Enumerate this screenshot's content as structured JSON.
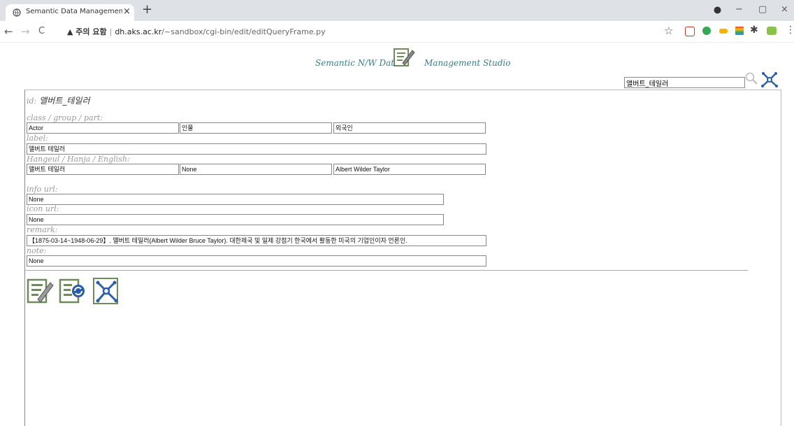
{
  "browser": {
    "tab_title": "Semantic Data Management St",
    "tab_close": "×",
    "new_tab": "+",
    "address": {
      "warning": "▲ 주의 요함",
      "separator": "|",
      "host": "dh.aks.ac.kr",
      "path": "/~sandbox/cgi-bin/edit/editQueryFrame.py"
    },
    "nav": {
      "back": "←",
      "forward": "→",
      "reload": "C"
    },
    "window": {
      "minimize": "−",
      "maximize": "▢",
      "close": "×"
    },
    "toolbar_icons": {
      "star": "☆",
      "puzzle": "✱",
      "menu": "⋮"
    }
  },
  "header": {
    "title_left": "Semantic N/W Data",
    "title_right": "Management Studio",
    "icon": "edit-document-icon"
  },
  "search": {
    "value": "앨버트_테일러"
  },
  "form": {
    "id_label": "id:",
    "id_value": "앨버트_테일러",
    "class_label": "class / group / part:",
    "class": "Actor",
    "group": "인물",
    "part": "외국인",
    "label_label": "label:",
    "label": "앨버트 테일러",
    "names_label": "Hangeul / Hanja / English:",
    "hangeul": "앨버트 테일러",
    "hanja": "None",
    "english": "Albert Wilder Taylor",
    "info_url_label": "info url:",
    "info_url": "None",
    "icon_url_label": "icon url:",
    "icon_url": "None",
    "remark_label": "remark:",
    "remark": "【1875-03-14~1948-06-29】. 앨버트 테일러(Albert Wilder Bruce Taylor). 대한제국 및 일제 강점기 한국에서 활동한 미국의 기업인이자 언론인.",
    "note_label": "note:",
    "note": "None"
  },
  "actions": [
    "edit-icon",
    "refresh-document-icon",
    "network-graph-icon"
  ],
  "colors": {
    "accent": "#3a7d85",
    "icon_green": "#6f8a5c",
    "icon_blue": "#2a5fa8"
  }
}
